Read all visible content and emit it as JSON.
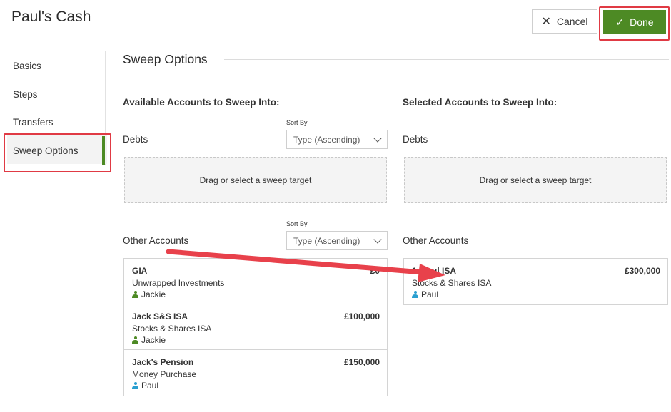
{
  "window": {
    "title": "Paul's Cash"
  },
  "toolbar": {
    "cancel_label": "Cancel",
    "done_label": "Done"
  },
  "sidebar": {
    "items": [
      {
        "label": "Basics"
      },
      {
        "label": "Steps"
      },
      {
        "label": "Transfers"
      },
      {
        "label": "Sweep Options",
        "active": true
      }
    ]
  },
  "section": {
    "title": "Sweep Options"
  },
  "available": {
    "heading": "Available Accounts to Sweep Into:",
    "debts": {
      "label": "Debts",
      "sort_label": "Sort By",
      "sort_value": "Type (Ascending)",
      "dropzone": "Drag or select a sweep target"
    },
    "other": {
      "label": "Other Accounts",
      "sort_label": "Sort By",
      "sort_value": "Type (Ascending)",
      "accounts": [
        {
          "name": "GIA",
          "value": "£0",
          "type": "Unwrapped Investments",
          "owner": "Jackie"
        },
        {
          "name": "Jack S&S ISA",
          "value": "£100,000",
          "type": "Stocks & Shares ISA",
          "owner": "Jackie"
        },
        {
          "name": "Jack's Pension",
          "value": "£150,000",
          "type": "Money Purchase",
          "owner": "Paul"
        }
      ]
    }
  },
  "selected": {
    "heading": "Selected Accounts to Sweep Into:",
    "debts": {
      "label": "Debts",
      "dropzone": "Drag or select a sweep target"
    },
    "other": {
      "label": "Other Accounts",
      "accounts": [
        {
          "name": "1. Paul ISA",
          "value": "£300,000",
          "type": "Stocks & Shares ISA",
          "owner": "Paul"
        }
      ]
    }
  },
  "colors": {
    "accent_green": "#4d8a24",
    "highlight_red": "#e03a44",
    "owner_jackie": "#4d8a24",
    "owner_paul": "#2a9fd0"
  }
}
